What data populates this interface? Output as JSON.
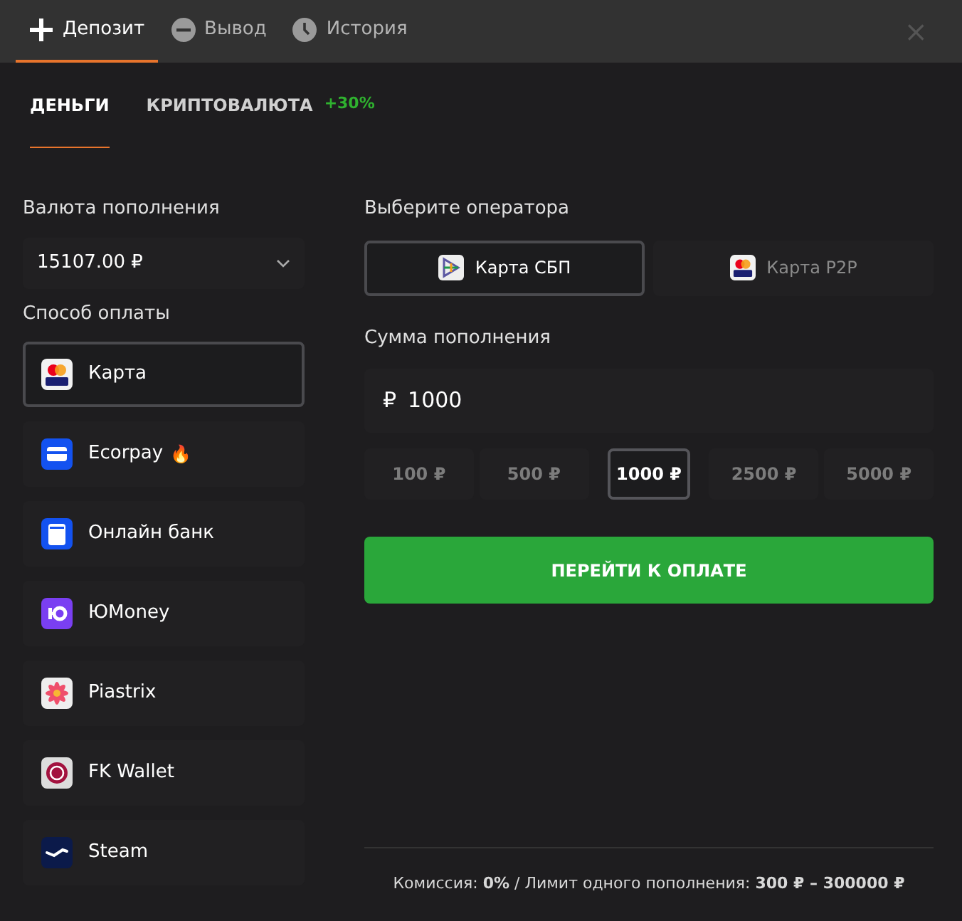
{
  "top_tabs": [
    {
      "label": "Депозит",
      "selected": true
    },
    {
      "label": "Вывод",
      "selected": false
    },
    {
      "label": "История",
      "selected": false
    }
  ],
  "close": "×",
  "sub_tabs": [
    {
      "label": "ДЕНЬГИ",
      "selected": true
    },
    {
      "label": "КРИПТОВАЛЮТА",
      "selected": false,
      "badge": "+30%"
    }
  ],
  "currency": {
    "label": "Валюта пополнения",
    "value": "15107.00 ₽"
  },
  "methods_label": "Способ оплаты",
  "methods": [
    {
      "label": "Карта",
      "selected": true
    },
    {
      "label": "Ecorpay",
      "badge": "🔥",
      "selected": false
    },
    {
      "label": "Онлайн банк",
      "selected": false
    },
    {
      "label": "ЮMoney",
      "selected": false
    },
    {
      "label": "Piastrix",
      "selected": false
    },
    {
      "label": "FK Wallet",
      "selected": false
    },
    {
      "label": "Steam",
      "selected": false
    }
  ],
  "operator_label": "Выберите оператора",
  "operators": [
    {
      "label": "Карта СБП",
      "selected": true
    },
    {
      "label": "Карта P2P",
      "selected": false
    }
  ],
  "amount_label": "Сумма пополнения",
  "amount": {
    "currency": "₽",
    "value": "1000"
  },
  "presets": [
    {
      "label": "100 ₽",
      "selected": false
    },
    {
      "label": "500 ₽",
      "selected": false
    },
    {
      "label": "1000 ₽",
      "selected": true
    },
    {
      "label": "2500 ₽",
      "selected": false
    },
    {
      "label": "5000 ₽",
      "selected": false
    }
  ],
  "pay_button": "ПЕРЕЙТИ К ОПЛАТЕ",
  "footer": "Комиссия: **0%** / Лимит одного пополнения:  **300 ₽ – 300000 ₽**"
}
